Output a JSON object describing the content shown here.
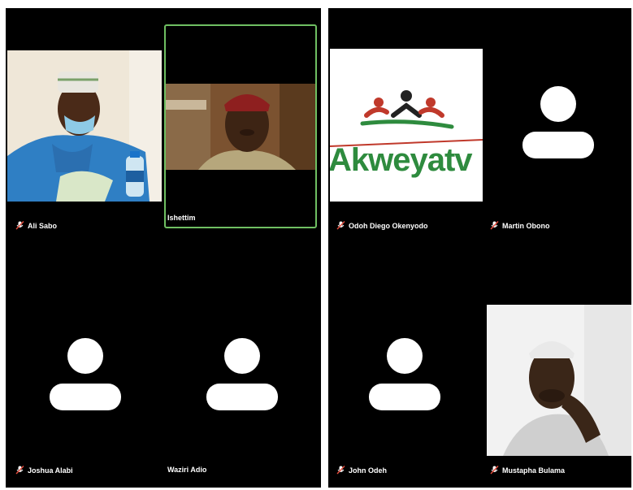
{
  "colors": {
    "background": "#000000",
    "speaking_border": "#6fbf62",
    "name_text": "#ffffff",
    "brand_red": "#c0392b",
    "brand_green": "#2e8b3e"
  },
  "participants": [
    {
      "name": "Ali Sabo",
      "type": "video",
      "muted": true
    },
    {
      "name": "Ishettim",
      "type": "video",
      "speaking": true,
      "muted": false
    },
    {
      "name": "Joshua Alabi",
      "type": "avatar",
      "muted": true
    },
    {
      "name": "Waziri Adio",
      "type": "avatar",
      "muted": false
    },
    {
      "name": "Odoh Diego Okenyodo",
      "type": "logo",
      "muted": true
    },
    {
      "name": "Martin Obono",
      "type": "avatar",
      "muted": true
    },
    {
      "name": "John Odeh",
      "type": "avatar",
      "muted": true
    },
    {
      "name": "Mustapha Bulama",
      "type": "video",
      "muted": true
    }
  ],
  "logo": {
    "text": "Akweyatv",
    "icon": "akweya-people-logo"
  },
  "icons": {
    "mute": "mic-off-icon",
    "avatar": "person-silhouette-icon"
  }
}
